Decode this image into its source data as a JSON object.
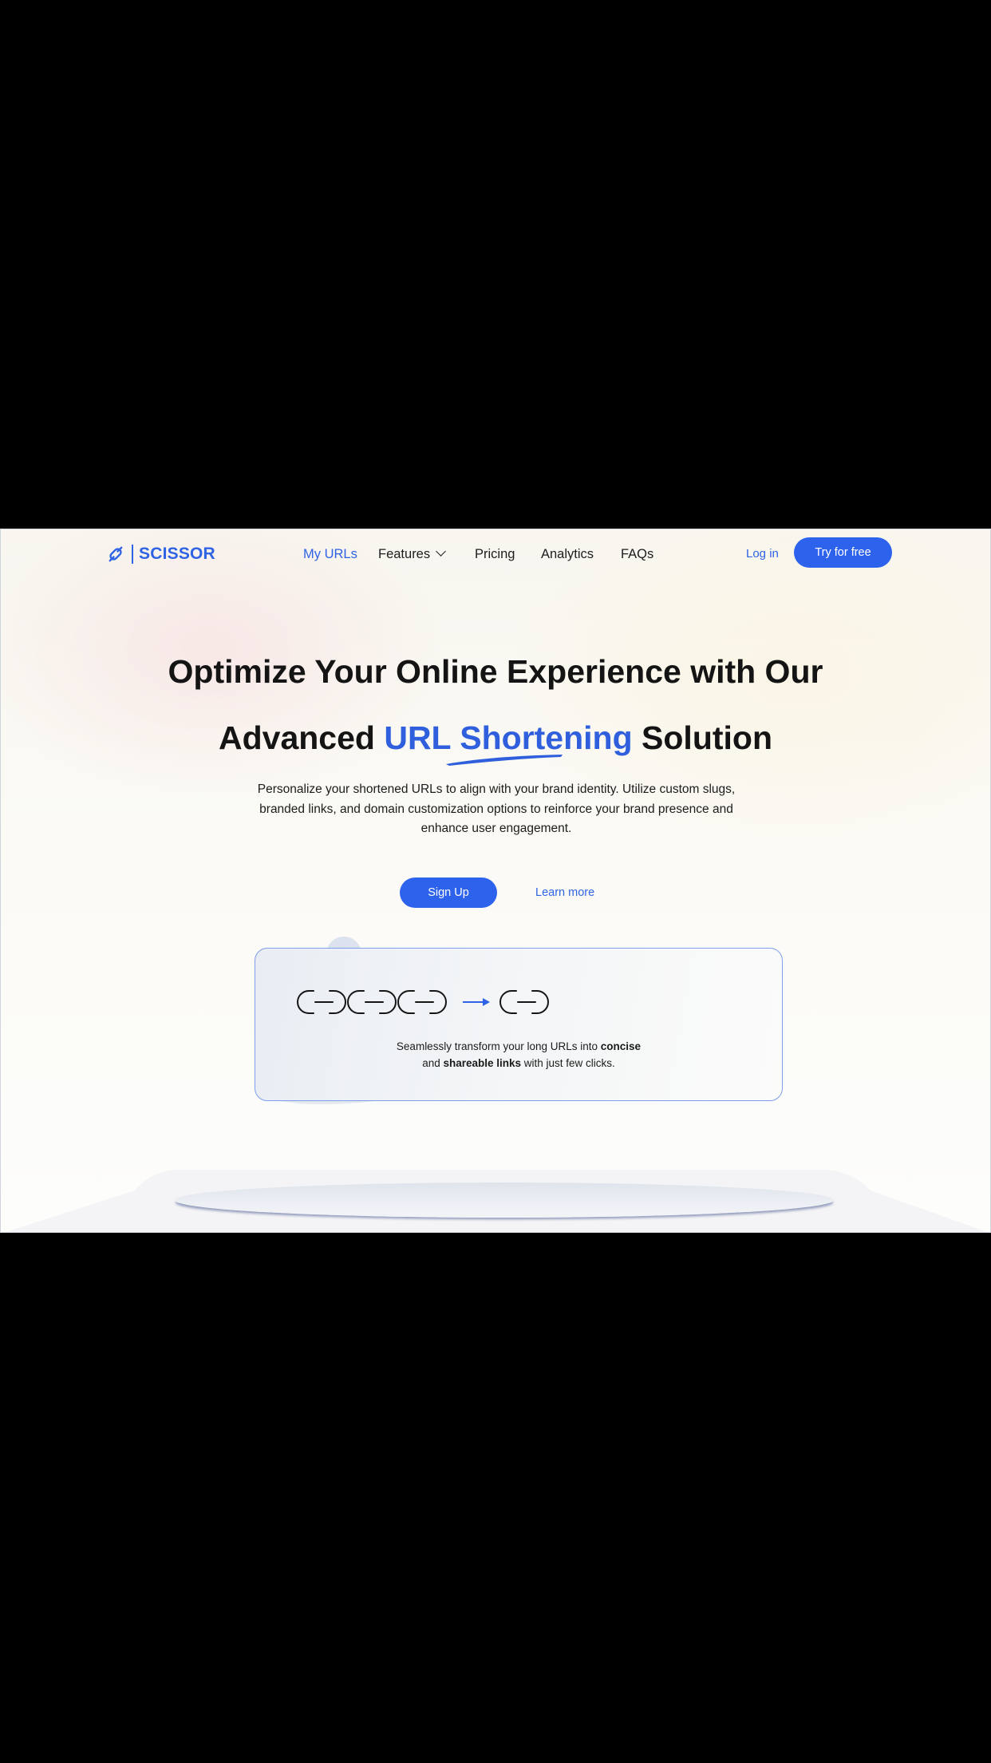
{
  "brand": {
    "name": "SCISSOR",
    "logo_icon": "scissor-link-icon",
    "color": "#2f63e6"
  },
  "nav": {
    "items": [
      {
        "label": "My URLs",
        "active": true
      },
      {
        "label": "Features",
        "has_dropdown": true
      },
      {
        "label": "Pricing"
      },
      {
        "label": "Analytics"
      },
      {
        "label": "FAQs"
      }
    ],
    "login": "Log in",
    "cta": "Try for free"
  },
  "hero": {
    "line1": "Optimize Your Online Experience with Our",
    "line2_prefix": "Advanced ",
    "line2_accent": "URL Shortening",
    "line2_suffix": " Solution",
    "subtitle": "Personalize your shortened URLs to align with your brand identity. Utilize custom slugs, branded links, and domain customization options to reinforce your brand presence and enhance user engagement.",
    "primary_button": "Sign Up",
    "secondary_link": "Learn more"
  },
  "card": {
    "text_1": "Seamlessly transform your long URLs into ",
    "bold_1": "concise",
    "text_2": "and ",
    "bold_2": "shareable links",
    "text_3": " with just few clicks.",
    "icons": [
      "long-chain-link-icon",
      "arrow-right-icon",
      "short-chain-link-icon"
    ]
  },
  "colors": {
    "accent": "#2d63ec",
    "heading": "#141414",
    "card_border": "#7d9eea"
  }
}
